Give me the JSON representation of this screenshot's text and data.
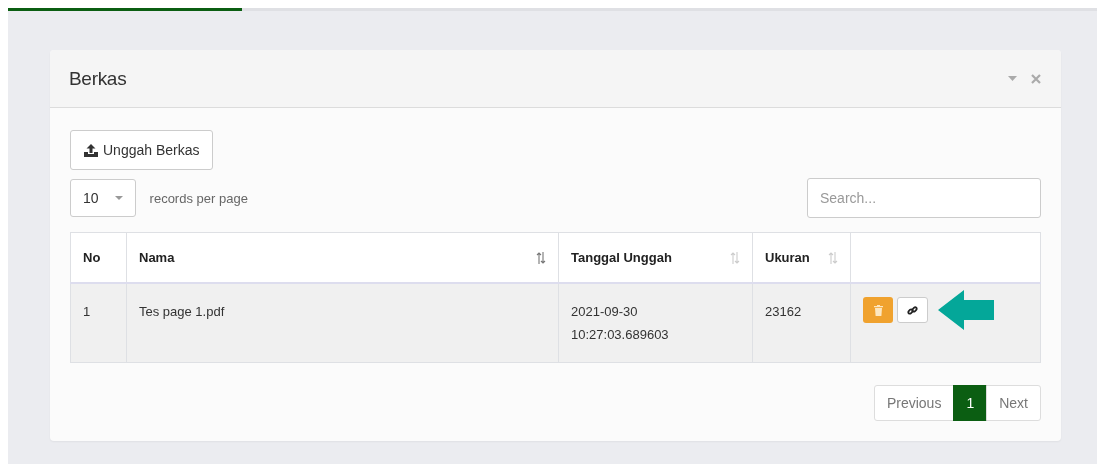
{
  "progress": {
    "level": 0.215
  },
  "panel": {
    "title": "Berkas",
    "upload_button": "Unggah Berkas",
    "page_size": "10",
    "page_size_label": "records per page",
    "search": {
      "placeholder": "Search..."
    }
  },
  "table": {
    "columns": [
      {
        "label": "No",
        "kind": "plain"
      },
      {
        "label": "Nama",
        "kind": "sorted"
      },
      {
        "label": "Tanggal Unggah",
        "kind": "sortable"
      },
      {
        "label": "Ukuran",
        "kind": "sortable"
      },
      {
        "kind": "plain"
      }
    ],
    "rows": [
      {
        "no": "1",
        "nama": "Tes page 1.pdf",
        "tanggal": [
          "2021-09-30",
          "10:27:03.689603"
        ],
        "ukuran": "23162"
      }
    ]
  },
  "pagination": {
    "previous": "Previous",
    "pages": [
      {
        "label": "1",
        "selected": true
      }
    ],
    "next": "Next"
  }
}
